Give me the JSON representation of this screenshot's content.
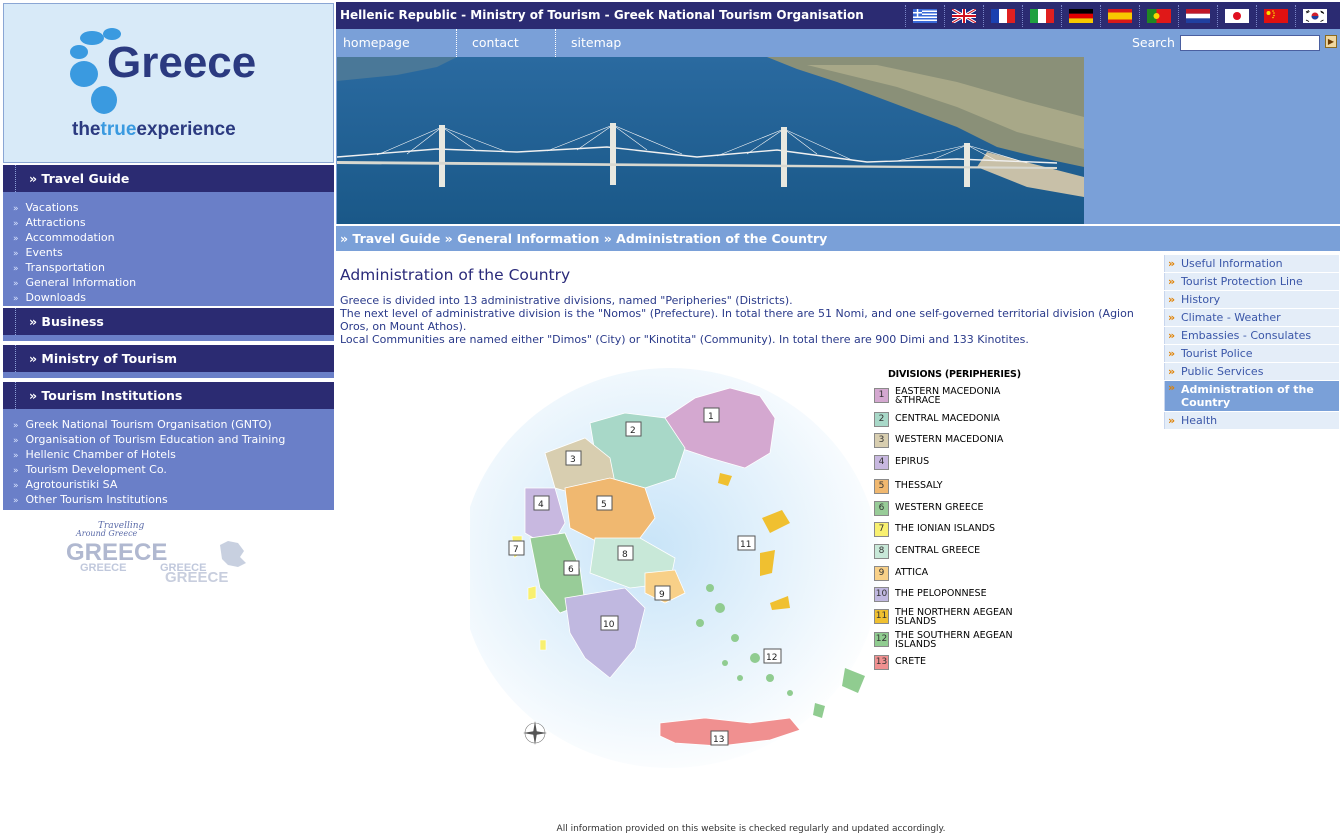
{
  "header": {
    "title": "Hellenic Republic - Ministry of Tourism - Greek National Tourism Organisation",
    "flags": [
      "greek-flag-icon",
      "uk-flag-icon",
      "french-flag-icon",
      "italian-flag-icon",
      "german-flag-icon",
      "spanish-flag-icon",
      "portuguese-flag-icon",
      "dutch-flag-icon",
      "japanese-flag-icon",
      "chinese-flag-icon",
      "korean-flag-icon"
    ]
  },
  "logo": {
    "word": "Greece",
    "tag_the": "the",
    "tag_true": "true",
    "tag_exp": "experience"
  },
  "nav": {
    "homepage": "homepage",
    "contact": "contact",
    "sitemap": "sitemap",
    "search_label": "Search"
  },
  "breadcrumb": "» Travel Guide » General Information » Administration of the Country",
  "sidebar": {
    "travel_guide": {
      "title": "» Travel Guide",
      "items": [
        "Vacations",
        "Attractions",
        "Accommodation",
        "Events",
        "Transportation",
        "General Information",
        "Downloads"
      ]
    },
    "business": {
      "title": "» Business"
    },
    "ministry": {
      "title": "» Ministry of Tourism"
    },
    "institutions": {
      "title": "» Tourism Institutions",
      "items": [
        "Greek National Tourism Organisation (GNTO)",
        "Organisation of Tourism Education and Training",
        "Hellenic Chamber of Hotels",
        "Tourism Development Co.",
        "Agrotouristiki SA",
        "Other Tourism Institutions"
      ]
    },
    "promo": {
      "line1": "Travelling",
      "line2": "Around Greece",
      "word": "GREECE"
    }
  },
  "main": {
    "title": "Administration of the Country",
    "paragraphs": [
      "Greece is divided into 13 administrative divisions, named \"Peripheries\" (Districts).",
      "The next level of administrative division is the \"Nomos\" (Prefecture). In total there are 51 Nomi, and one self-governed territorial division (Agion Oros, on Mount Athos).",
      "Local Communities are named either \"Dimos\" (City) or \"Kinotita\" (Community). In total there are 900 Dimi and 133 Kinotites."
    ]
  },
  "legend": {
    "title": "DIVISIONS (PERIPHERIES)",
    "items": [
      {
        "n": "1",
        "label": "EASTERN MACEDONIA &THRACE",
        "color": "#d4a8d0"
      },
      {
        "n": "2",
        "label": "CENTRAL MACEDONIA",
        "color": "#a8d8c8"
      },
      {
        "n": "3",
        "label": "WESTERN MACEDONIA",
        "color": "#d8ceb0"
      },
      {
        "n": "4",
        "label": "EPIRUS",
        "color": "#c8b8e0"
      },
      {
        "n": "5",
        "label": "THESSALY",
        "color": "#f0b870"
      },
      {
        "n": "6",
        "label": "WESTERN GREECE",
        "color": "#98cc98"
      },
      {
        "n": "7",
        "label": "THE IONIAN ISLANDS",
        "color": "#f8f070"
      },
      {
        "n": "8",
        "label": "CENTRAL GREECE",
        "color": "#c8e8d8"
      },
      {
        "n": "9",
        "label": "ATTICA",
        "color": "#f8d088"
      },
      {
        "n": "10",
        "label": "THE PELOPONNESE",
        "color": "#c0b8e0"
      },
      {
        "n": "11",
        "label": "THE NORTHERN AEGEAN ISLANDS",
        "color": "#f0c030"
      },
      {
        "n": "12",
        "label": "THE SOUTHERN AEGEAN ISLANDS",
        "color": "#90cc90"
      },
      {
        "n": "13",
        "label": "CRETE",
        "color": "#f09090"
      }
    ]
  },
  "right_nav": [
    "Useful Information",
    "Tourist Protection Line",
    "History",
    "Climate - Weather",
    "Embassies - Consulates",
    "Tourist Police",
    "Public Services",
    "Administration of the Country",
    "Health"
  ],
  "right_nav_active": "Administration of the Country",
  "footer": "All information provided on this website is checked regularly and updated accordingly."
}
